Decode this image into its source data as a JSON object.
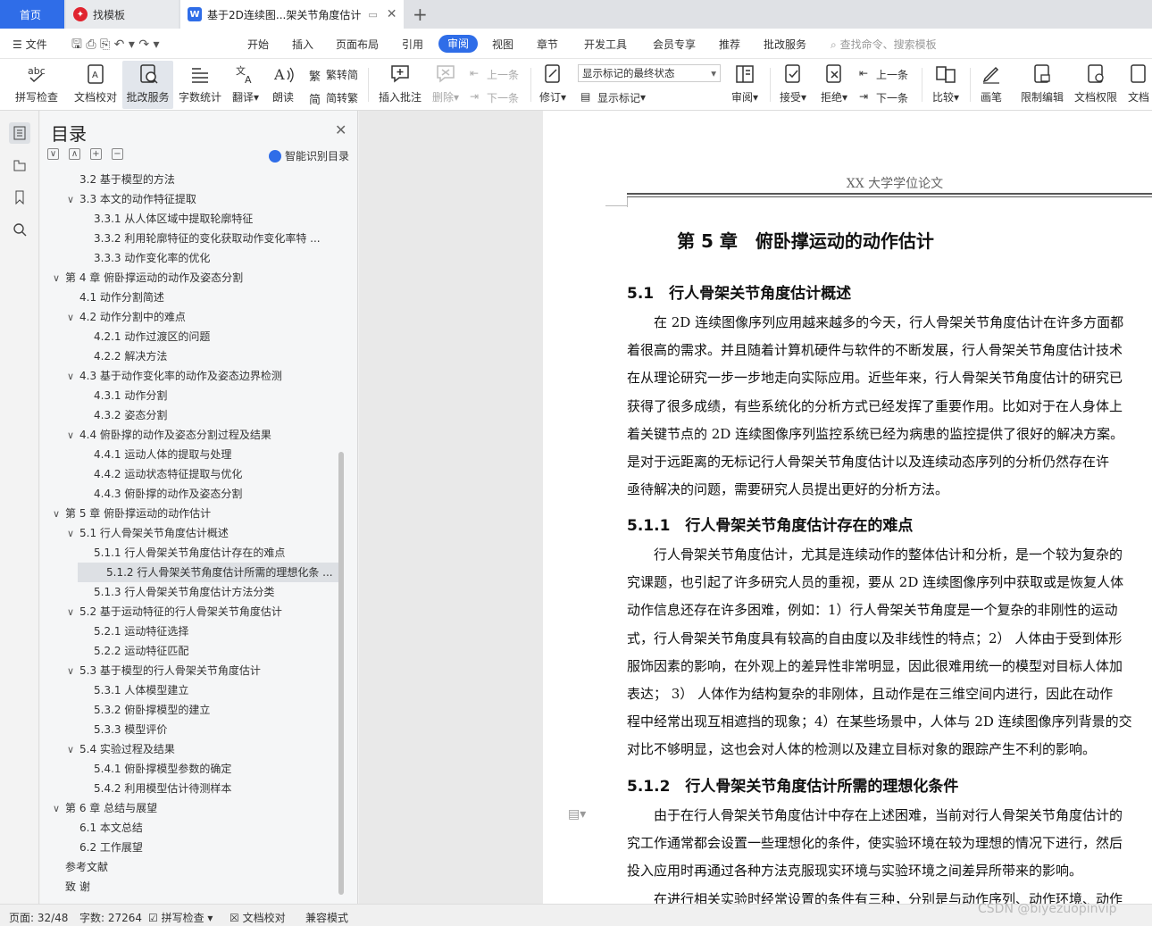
{
  "tabs": {
    "home": "首页",
    "template": "找模板",
    "doc": "基于2D连续图...架关节角度估计"
  },
  "menu": {
    "file": "文件",
    "items": [
      "开始",
      "插入",
      "页面布局",
      "引用",
      "审阅",
      "视图",
      "章节",
      "开发工具",
      "会员专享",
      "推荐",
      "批改服务"
    ],
    "search": "查找命令、搜索模板"
  },
  "toolbar": {
    "spell": "拼写检查",
    "proof": "文档校对",
    "grading": "批改服务",
    "wordcount": "字数统计",
    "translate": "翻译",
    "read": "朗读",
    "t2s": "繁转简",
    "s2t": "简转繁",
    "comment": "插入批注",
    "delete": "删除",
    "prev1": "上一条",
    "next1": "下一条",
    "track": "修订",
    "status_select": "显示标记的最终状态",
    "show_marks": "显示标记",
    "review": "审阅",
    "accept": "接受",
    "reject": "拒绝",
    "prev2": "上一条",
    "next2": "下一条",
    "compare": "比较",
    "pen": "画笔",
    "restrict": "限制编辑",
    "perm": "文档权限",
    "more": "文档"
  },
  "nav": {
    "title": "目录",
    "smart": "智能识别目录",
    "toc": [
      {
        "level": 2,
        "text": "3.2 基于模型的方法",
        "arrow": ""
      },
      {
        "level": 2,
        "text": "3.3 本文的动作特征提取",
        "arrow": "∨"
      },
      {
        "level": 3,
        "text": "3.3.1 从人体区域中提取轮廓特征",
        "arrow": ""
      },
      {
        "level": 3,
        "text": "3.3.2 利用轮廓特征的变化获取动作变化率特 ...",
        "arrow": ""
      },
      {
        "level": 3,
        "text": "3.3.3 动作变化率的优化",
        "arrow": ""
      },
      {
        "level": 1,
        "text": "第 4 章 俯卧撑运动的动作及姿态分割",
        "arrow": "∨"
      },
      {
        "level": 2,
        "text": "4.1 动作分割简述",
        "arrow": ""
      },
      {
        "level": 2,
        "text": "4.2 动作分割中的难点",
        "arrow": "∨"
      },
      {
        "level": 3,
        "text": "4.2.1 动作过渡区的问题",
        "arrow": ""
      },
      {
        "level": 3,
        "text": "4.2.2 解决方法",
        "arrow": ""
      },
      {
        "level": 2,
        "text": "4.3 基于动作变化率的动作及姿态边界检测",
        "arrow": "∨"
      },
      {
        "level": 3,
        "text": "4.3.1 动作分割",
        "arrow": ""
      },
      {
        "level": 3,
        "text": "4.3.2 姿态分割",
        "arrow": ""
      },
      {
        "level": 2,
        "text": "4.4 俯卧撑的动作及姿态分割过程及结果",
        "arrow": "∨"
      },
      {
        "level": 3,
        "text": "4.4.1 运动人体的提取与处理",
        "arrow": ""
      },
      {
        "level": 3,
        "text": "4.4.2 运动状态特征提取与优化",
        "arrow": ""
      },
      {
        "level": 3,
        "text": "4.4.3 俯卧撑的动作及姿态分割",
        "arrow": ""
      },
      {
        "level": 1,
        "text": "第 5 章 俯卧撑运动的动作估计",
        "arrow": "∨"
      },
      {
        "level": 2,
        "text": "5.1 行人骨架关节角度估计概述",
        "arrow": "∨"
      },
      {
        "level": 3,
        "text": "5.1.1 行人骨架关节角度估计存在的难点",
        "arrow": ""
      },
      {
        "level": 3,
        "text": "5.1.2 行人骨架关节角度估计所需的理想化条 ...",
        "arrow": "",
        "selected": true
      },
      {
        "level": 3,
        "text": "5.1.3 行人骨架关节角度估计方法分类",
        "arrow": ""
      },
      {
        "level": 2,
        "text": "5.2 基于运动特征的行人骨架关节角度估计",
        "arrow": "∨"
      },
      {
        "level": 3,
        "text": "5.2.1 运动特征选择",
        "arrow": ""
      },
      {
        "level": 3,
        "text": "5.2.2 运动特征匹配",
        "arrow": ""
      },
      {
        "level": 2,
        "text": "5.3 基于模型的行人骨架关节角度估计",
        "arrow": "∨"
      },
      {
        "level": 3,
        "text": "5.3.1 人体模型建立",
        "arrow": ""
      },
      {
        "level": 3,
        "text": "5.3.2 俯卧撑模型的建立",
        "arrow": ""
      },
      {
        "level": 3,
        "text": "5.3.3 模型评价",
        "arrow": ""
      },
      {
        "level": 2,
        "text": "5.4 实验过程及结果",
        "arrow": "∨"
      },
      {
        "level": 3,
        "text": "5.4.1 俯卧撑模型参数的确定",
        "arrow": ""
      },
      {
        "level": 3,
        "text": "5.4.2 利用模型估计待测样本",
        "arrow": ""
      },
      {
        "level": 1,
        "text": "第 6 章 总结与展望",
        "arrow": "∨"
      },
      {
        "level": 2,
        "text": "6.1 本文总结",
        "arrow": ""
      },
      {
        "level": 2,
        "text": "6.2 工作展望",
        "arrow": ""
      },
      {
        "level": 1,
        "text": "参考文献",
        "arrow": ""
      },
      {
        "level": 1,
        "text": "致 谢",
        "arrow": ""
      }
    ]
  },
  "doc": {
    "header": "XX 大学学位论文",
    "chapter": "第 5 章　俯卧撑运动的动作估计",
    "h51": "5.1　行人骨架关节角度估计概述",
    "p1": [
      "　　在 2D 连续图像序列应用越来越多的今天，行人骨架关节角度估计在许多方面都",
      "着很高的需求。并且随着计算机硬件与软件的不断发展，行人骨架关节角度估计技术",
      "在从理论研究一步一步地走向实际应用。近些年来，行人骨架关节角度估计的研究已",
      "获得了很多成绩，有些系统化的分析方式已经发挥了重要作用。比如对于在人身体上",
      "着关键节点的 2D 连续图像序列监控系统已经为病患的监控提供了很好的解决方案。",
      "是对于远距离的无标记行人骨架关节角度估计以及连续动态序列的分析仍然存在许",
      "亟待解决的问题，需要研究人员提出更好的分析方法。"
    ],
    "h511": "5.1.1　行人骨架关节角度估计存在的难点",
    "p2": [
      "　　行人骨架关节角度估计，尤其是连续动作的整体估计和分析，是一个较为复杂的",
      "究课题，也引起了许多研究人员的重视，要从 2D 连续图像序列中获取或是恢复人体",
      "动作信息还存在许多困难，例如：1）行人骨架关节角度是一个复杂的非刚性的运动",
      "式，行人骨架关节角度具有较高的自由度以及非线性的特点；2） 人体由于受到体形",
      "服饰因素的影响，在外观上的差异性非常明显，因此很难用统一的模型对目标人体加",
      "表达； 3） 人体作为结构复杂的非刚体，且动作是在三维空间内进行，因此在动作",
      "程中经常出现互相遮挡的现象；4）在某些场景中，人体与 2D 连续图像序列背景的交",
      "对比不够明显，这也会对人体的检测以及建立目标对象的跟踪产生不利的影响。"
    ],
    "h512": "5.1.2　行人骨架关节角度估计所需的理想化条件",
    "p3": [
      "　　由于在行人骨架关节角度估计中存在上述困难，当前对行人骨架关节角度估计的",
      "究工作通常都会设置一些理想化的条件，使实验环境在较为理想的情况下进行，然后",
      "投入应用时再通过各种方法克服现实环境与实验环境之间差异所带来的影响。",
      "　　在进行相关实验时经常设置的条件有三种，分别是与动作序列、动作环境、动作"
    ]
  },
  "status": {
    "page": "页面: 32/48",
    "words": "字数: 27264",
    "spell": "拼写检查",
    "proof": "文档校对",
    "compat": "兼容模式"
  },
  "watermark": "CSDN @biyezuopinvip",
  "colors": {
    "accent": "#2f6de8",
    "wps_red": "#e0242f"
  }
}
